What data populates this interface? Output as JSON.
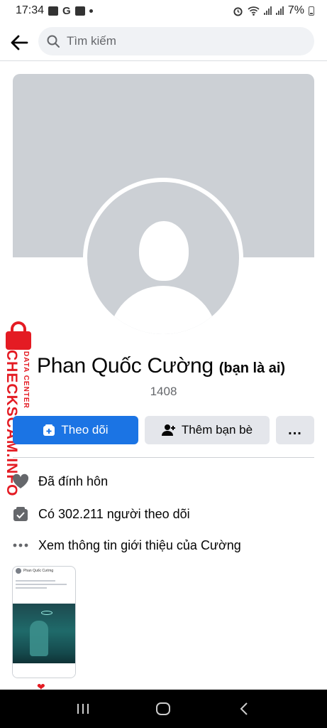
{
  "status_bar": {
    "time": "17:34",
    "battery_percent": "7%"
  },
  "search": {
    "placeholder": "Tìm kiếm"
  },
  "profile": {
    "name": "Phan Quốc Cường",
    "nickname": "(bạn là ai)",
    "id_number": "1408"
  },
  "actions": {
    "follow_label": "Theo dõi",
    "add_friend_label": "Thêm bạn bè",
    "more_label": "..."
  },
  "info": {
    "relationship": "Đã đính hôn",
    "followers": "Có 302.211 người theo dõi",
    "about_link": "Xem thông tin giới thiệu của Cường"
  },
  "watermark": {
    "main": "CHECKSCAM.INFO",
    "sub": "DATA CENTER"
  },
  "post_thumbnail": {
    "author": "Phan Quốc Cường"
  },
  "colors": {
    "primary_blue": "#1b74e4",
    "secondary_gray": "#e4e6eb",
    "cover_gray": "#ccd0d5",
    "watermark_red": "#e41b23"
  },
  "icons": {
    "back": "arrow-left-icon",
    "search": "search-icon",
    "follow": "follow-plus-icon",
    "add_friend": "person-add-icon",
    "relationship": "heart-icon",
    "followers": "followers-check-icon",
    "about": "dots-icon"
  }
}
